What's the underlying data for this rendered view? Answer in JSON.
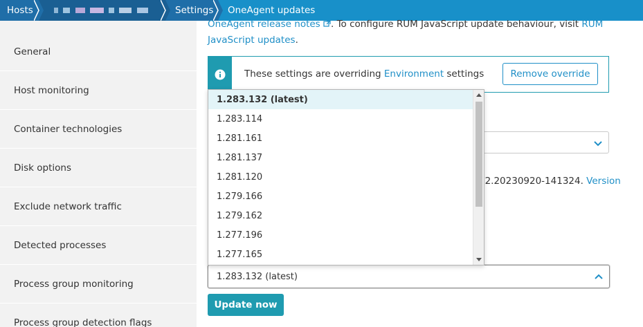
{
  "breadcrumb": {
    "items": [
      "Hosts",
      "",
      "Settings",
      "OneAgent updates"
    ]
  },
  "sidebar": {
    "items": [
      {
        "label": "General"
      },
      {
        "label": "Host monitoring"
      },
      {
        "label": "Container technologies"
      },
      {
        "label": "Disk options"
      },
      {
        "label": "Exclude network traffic"
      },
      {
        "label": "Detected processes"
      },
      {
        "label": "Process group monitoring"
      },
      {
        "label": "Process group detection flags"
      }
    ]
  },
  "intro": {
    "link1": "OneAgent release notes",
    "text": ". To configure RUM JavaScript update behaviour, visit ",
    "link2": "RUM JavaScript updates",
    "end": "."
  },
  "notice": {
    "prefix": "These settings are overriding ",
    "link": "Environment",
    "suffix": " settings",
    "button": "Remove override"
  },
  "info_line": {
    "text": "72.20230920-141324. ",
    "link": "Version"
  },
  "version_dropdown": {
    "options": [
      "1.283.132 (latest)",
      "1.283.114",
      "1.281.161",
      "1.281.137",
      "1.281.120",
      "1.279.166",
      "1.279.162",
      "1.277.196",
      "1.277.165"
    ],
    "selected": "1.283.132 (latest)"
  },
  "actions": {
    "update_now": "Update now"
  },
  "colors": {
    "accent": "#1f9bb0",
    "link": "#1f8fc7",
    "breadcrumb_active": "#1890c9"
  }
}
